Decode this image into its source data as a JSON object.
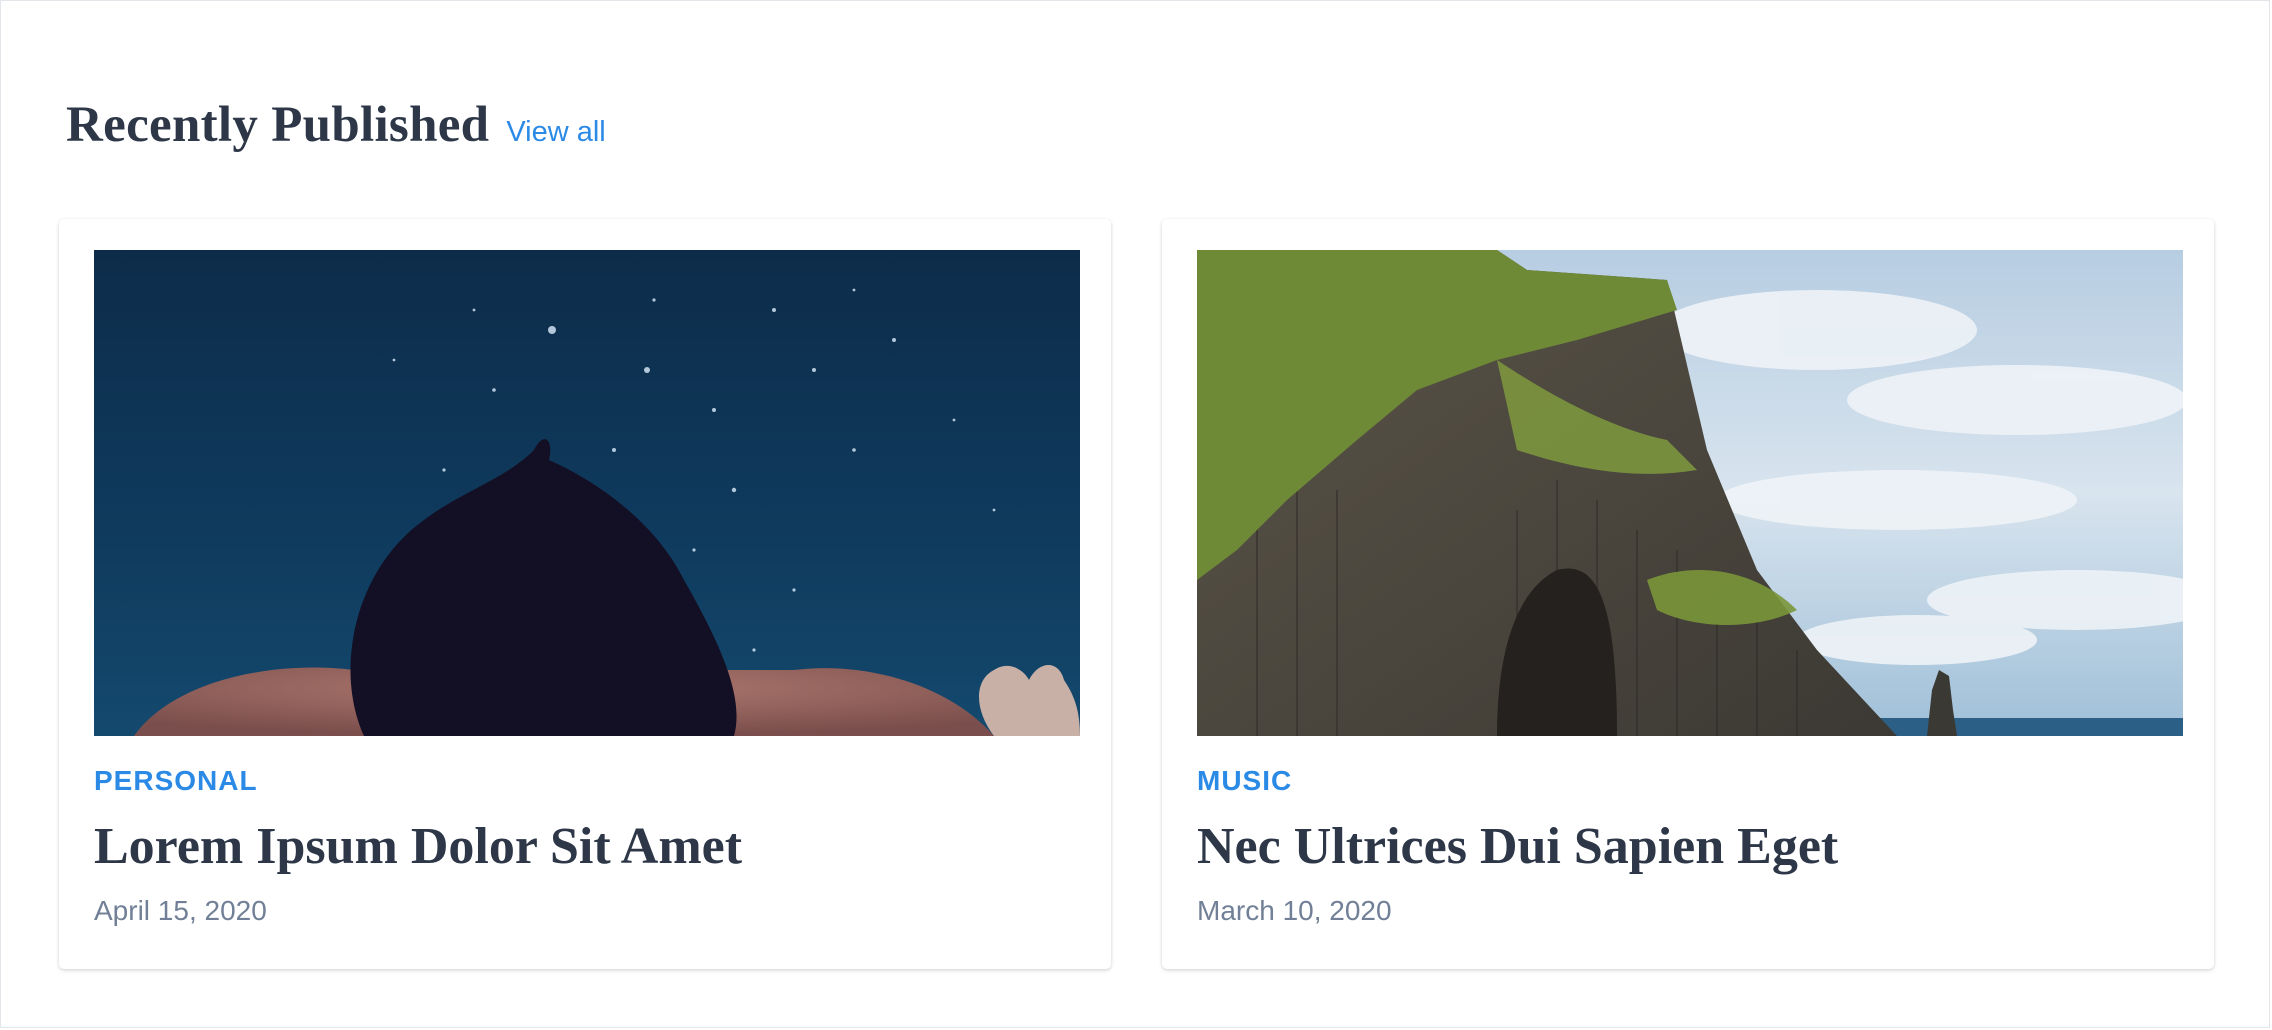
{
  "section": {
    "title": "Recently Published",
    "view_all_label": "View all"
  },
  "posts": [
    {
      "category": "PERSONAL",
      "title": "Lorem Ipsum Dolor Sit Amet",
      "date": "April 15, 2020",
      "image": "underwater-swimmer-photo"
    },
    {
      "category": "MUSIC",
      "title": "Nec Ultrices Dui Sapien Eget",
      "date": "March 10, 2020",
      "image": "sea-cliff-photo"
    }
  ],
  "colors": {
    "accent": "#2b8ae6",
    "heading": "#2d3748",
    "muted": "#718096",
    "border": "#e2e5ea"
  }
}
